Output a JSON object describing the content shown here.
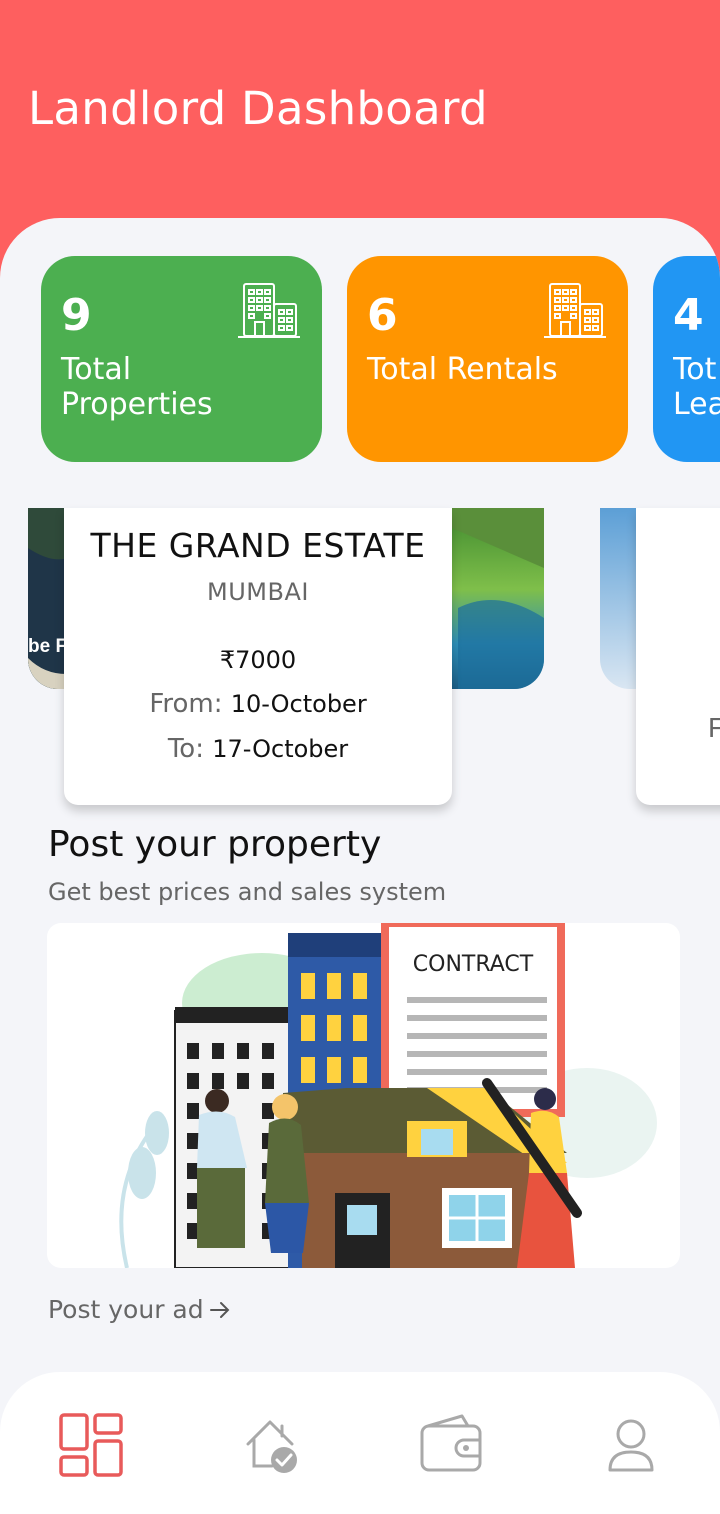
{
  "header": {
    "title": "Landlord Dashboard"
  },
  "stats": [
    {
      "number": "9",
      "label": "Total Properties",
      "color": "#4caf50",
      "icon": "building-icon"
    },
    {
      "number": "6",
      "label": "Total Rentals",
      "color": "#ff9500",
      "icon": "building-icon"
    },
    {
      "number": "4",
      "label": "Tot Lea",
      "color": "#2196f3",
      "icon": "building-icon"
    }
  ],
  "properties": [
    {
      "name": "THE GRAND ESTATE",
      "city": "MUMBAI",
      "price": "₹7000",
      "from_label": "From:",
      "from_value": "10-October",
      "to_label": "To:",
      "to_value": "17-October",
      "image_caption": "be F"
    },
    {
      "partial_text": "F"
    }
  ],
  "post": {
    "title": "Post your property",
    "subtitle": "Get best prices and sales system",
    "illustration_text": "CONTRACT",
    "link_label": "Post your ad"
  },
  "nav": [
    {
      "icon": "dashboard-icon",
      "active": true
    },
    {
      "icon": "home-check-icon",
      "active": false
    },
    {
      "icon": "wallet-icon",
      "active": false
    },
    {
      "icon": "profile-icon",
      "active": false
    }
  ],
  "colors": {
    "header_bg": "#fe5f5f",
    "page_bg": "#f4f5f9",
    "nav_active": "#e85a5a",
    "nav_inactive": "#a9a9a9"
  }
}
